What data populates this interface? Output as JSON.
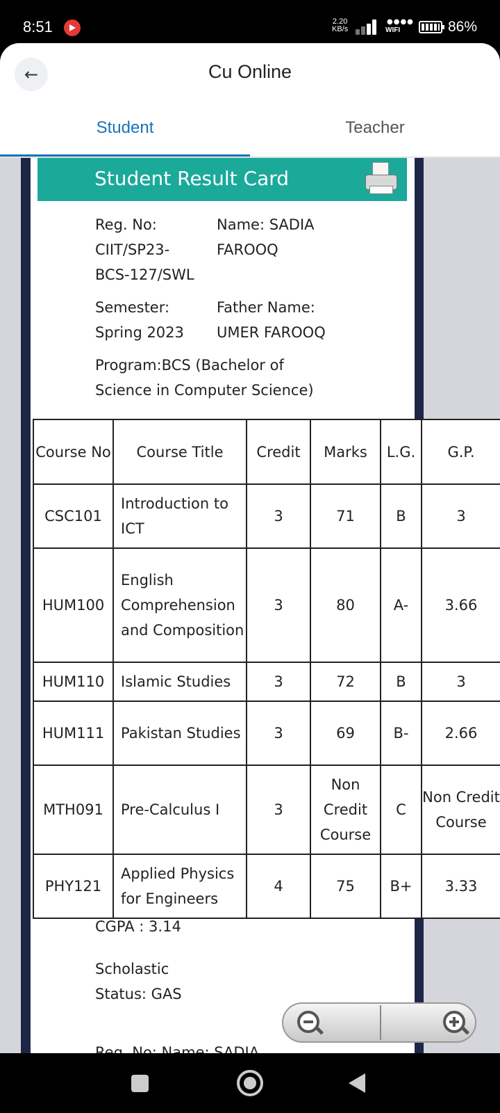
{
  "status_bar": {
    "time": "8:51",
    "net_speed_value": "2.20",
    "net_speed_unit": "KB/s",
    "wifi_label": "WIFI",
    "battery": "86%"
  },
  "header": {
    "title": "Cu Online",
    "back_icon": "arrow-left-icon",
    "tabs": [
      {
        "label": "Student",
        "active": true
      },
      {
        "label": "Teacher",
        "active": false
      }
    ],
    "accent_color": "#1a73b8"
  },
  "card": {
    "title": "Student Result Card",
    "title_bar_color": "#1ba99a",
    "print_icon": "printer-icon",
    "reg_label": "Reg. No:",
    "reg_value_line1": "CIIT/SP23-",
    "reg_value_line2": "BCS-127/SWL",
    "name_label": "Name: SADIA",
    "name_line2": "FAROOQ",
    "semester_label": "Semester:",
    "semester_value": "Spring 2023",
    "father_label": "Father Name:",
    "father_value": "UMER FAROOQ",
    "program_line1": "Program:BCS (Bachelor of",
    "program_line2": "Science in Computer Science)",
    "cgpa": "CGPA : 3.14",
    "status_line1": "Scholastic",
    "status_line2": "Status: GAS",
    "cut_off_text": "Reg. No:  Name: SADIA"
  },
  "table": {
    "headers": {
      "course_no": "Course No",
      "course_title": "Course Title",
      "credit": "Credit",
      "marks": "Marks",
      "lg": "L.G.",
      "gp": "G.P."
    },
    "rows": [
      {
        "no": "CSC101",
        "title": "Introduction to ICT",
        "credit": "3",
        "marks": "71",
        "lg": "B",
        "gp": "3"
      },
      {
        "no": "HUM100",
        "title": "English Comprehension and Composition",
        "credit": "3",
        "marks": "80",
        "lg": "A-",
        "gp": "3.66"
      },
      {
        "no": "HUM110",
        "title": "Islamic Studies",
        "credit": "3",
        "marks": "72",
        "lg": "B",
        "gp": "3"
      },
      {
        "no": "HUM111",
        "title": "Pakistan Studies",
        "credit": "3",
        "marks": "69",
        "lg": "B-",
        "gp": "2.66"
      },
      {
        "no": "MTH091",
        "title": "Pre-Calculus I",
        "credit": "3",
        "marks": "Non Credit Course",
        "lg": "C",
        "gp": "Non Credit Course"
      },
      {
        "no": "PHY121",
        "title": "Applied Physics for Engineers",
        "credit": "4",
        "marks": "75",
        "lg": "B+",
        "gp": "3.33"
      }
    ]
  },
  "zoom": {
    "out_icon": "zoom-out-icon",
    "in_icon": "zoom-in-icon"
  },
  "nav": {
    "recent_icon": "recent-apps-icon",
    "home_icon": "home-icon",
    "back_icon": "back-triangle-icon"
  }
}
